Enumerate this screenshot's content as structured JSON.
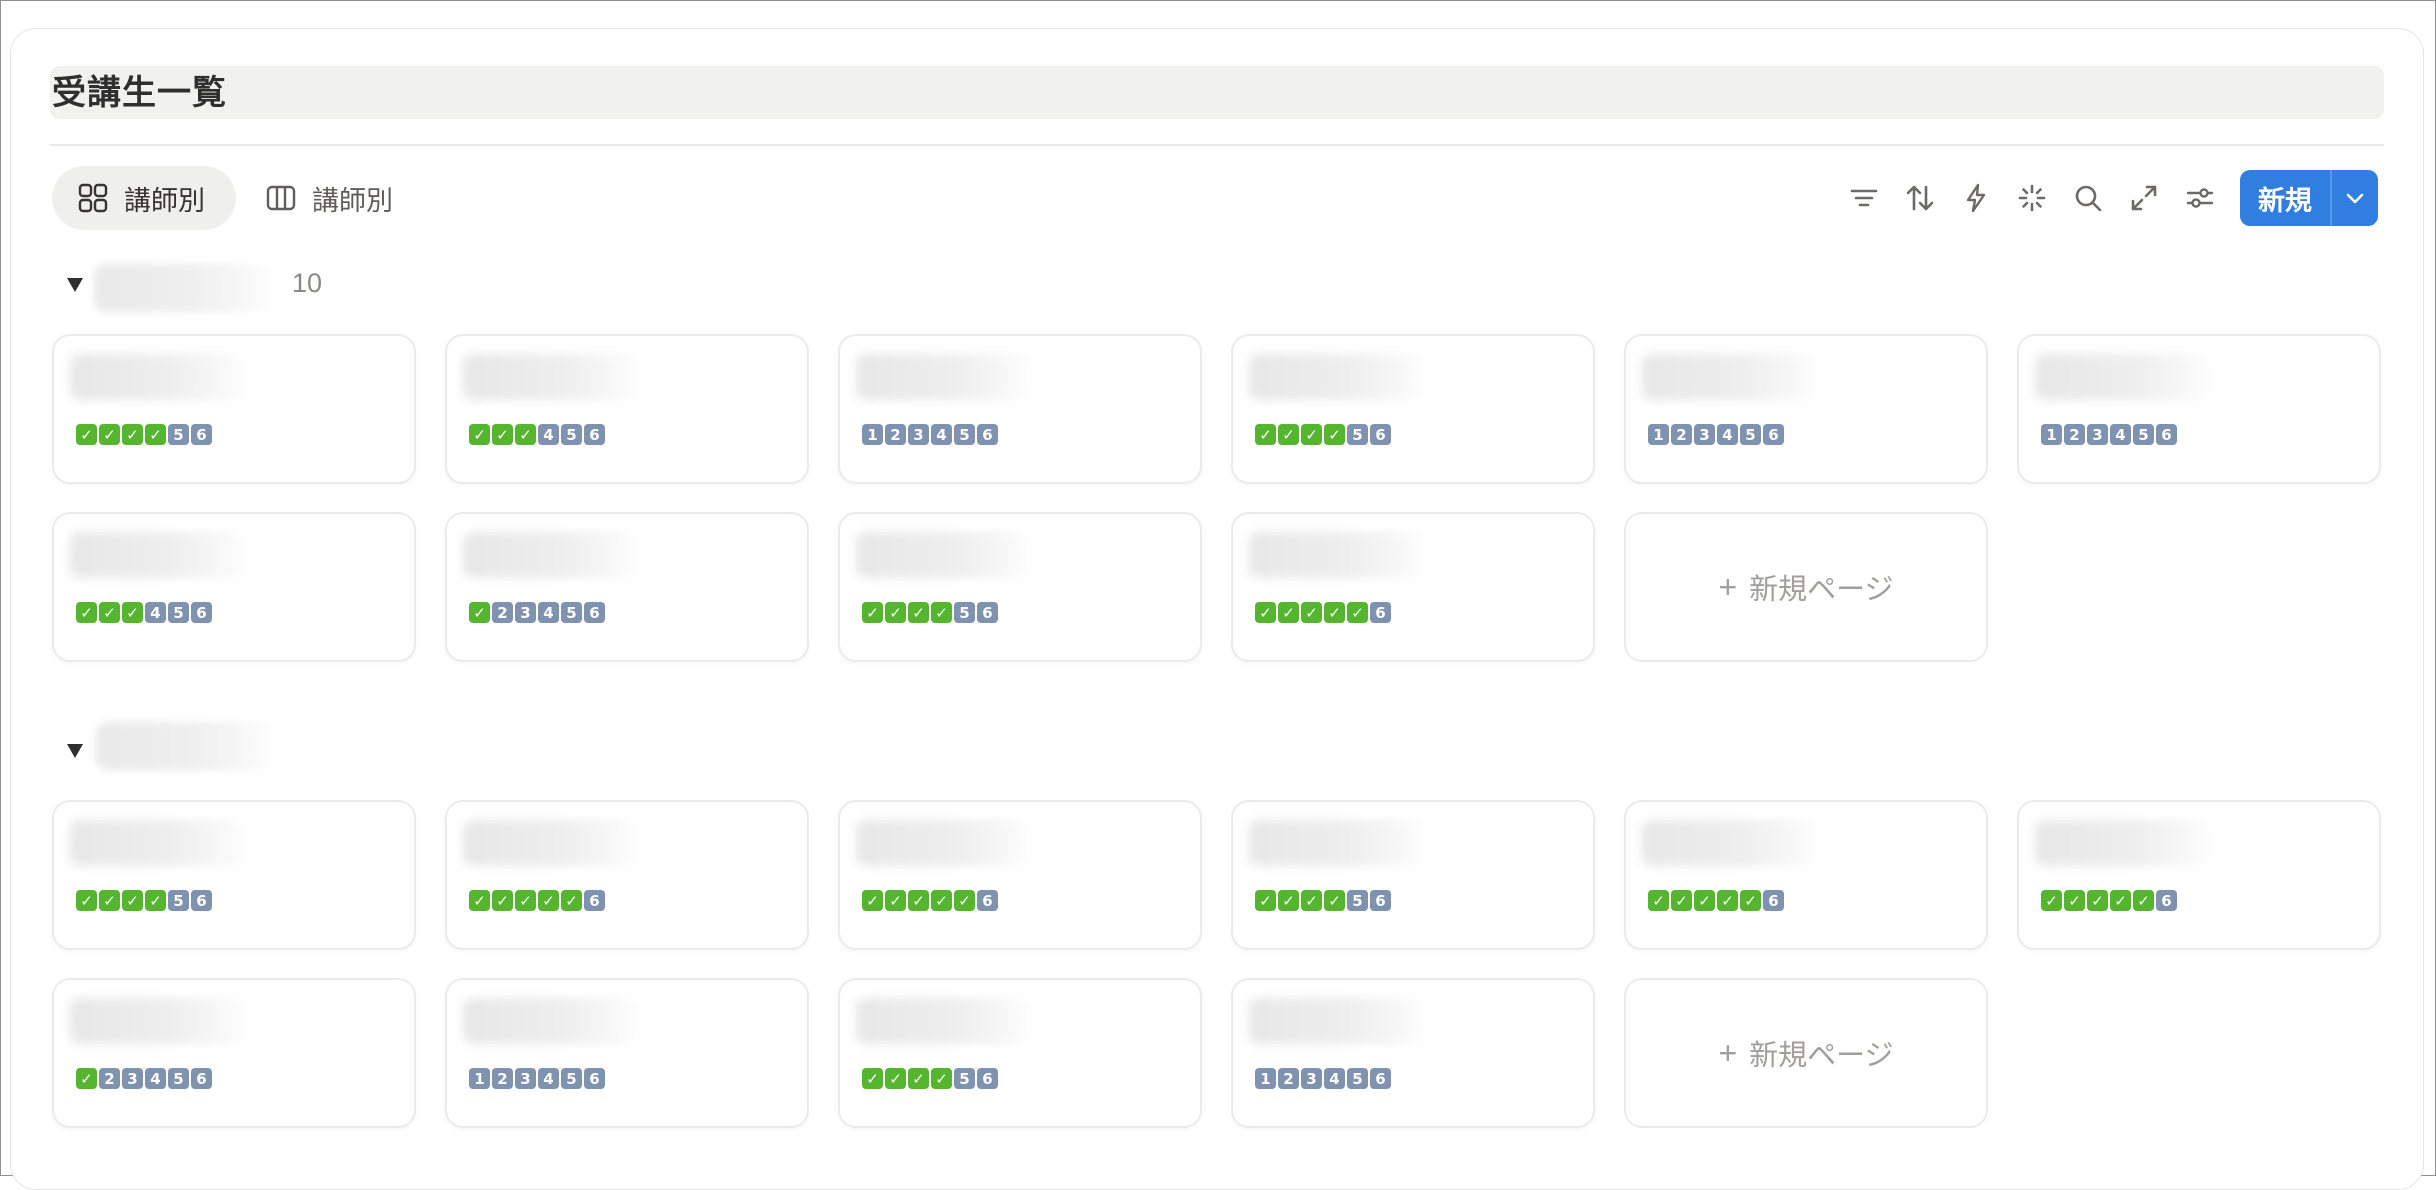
{
  "page": {
    "title": "受講生一覧"
  },
  "views": [
    {
      "label": "講師別",
      "icon": "gallery-grid-icon",
      "active": true
    },
    {
      "label": "講師別",
      "icon": "board-columns-icon",
      "active": false
    }
  ],
  "toolbar": {
    "icons": [
      "filter-icon",
      "sort-icon",
      "automation-bolt-icon",
      "ai-sparkle-icon",
      "search-icon",
      "expand-icon",
      "settings-sliders-icon"
    ],
    "new_label": "新規",
    "new_caret_icon": "chevron-down-icon",
    "accent_color": "#2f7ee0"
  },
  "groups": [
    {
      "count": "10",
      "cards": [
        {
          "progress": [
            "✓",
            "✓",
            "✓",
            "✓",
            "5",
            "6"
          ]
        },
        {
          "progress": [
            "✓",
            "✓",
            "✓",
            "4",
            "5",
            "6"
          ]
        },
        {
          "progress": [
            "1",
            "2",
            "3",
            "4",
            "5",
            "6"
          ]
        },
        {
          "progress": [
            "✓",
            "✓",
            "✓",
            "✓",
            "5",
            "6"
          ]
        },
        {
          "progress": [
            "1",
            "2",
            "3",
            "4",
            "5",
            "6"
          ]
        },
        {
          "progress": [
            "1",
            "2",
            "3",
            "4",
            "5",
            "6"
          ]
        },
        {
          "progress": [
            "✓",
            "✓",
            "✓",
            "4",
            "5",
            "6"
          ]
        },
        {
          "progress": [
            "✓",
            "2",
            "3",
            "4",
            "5",
            "6"
          ]
        },
        {
          "progress": [
            "✓",
            "✓",
            "✓",
            "✓",
            "5",
            "6"
          ]
        },
        {
          "progress": [
            "✓",
            "✓",
            "✓",
            "✓",
            "✓",
            "6"
          ]
        }
      ],
      "new_page_label": "新規ページ"
    },
    {
      "count": "",
      "cards": [
        {
          "progress": [
            "✓",
            "✓",
            "✓",
            "✓",
            "5",
            "6"
          ]
        },
        {
          "progress": [
            "✓",
            "✓",
            "✓",
            "✓",
            "✓",
            "6"
          ]
        },
        {
          "progress": [
            "✓",
            "✓",
            "✓",
            "✓",
            "✓",
            "6"
          ]
        },
        {
          "progress": [
            "✓",
            "✓",
            "✓",
            "✓",
            "5",
            "6"
          ]
        },
        {
          "progress": [
            "✓",
            "✓",
            "✓",
            "✓",
            "✓",
            "6"
          ]
        },
        {
          "progress": [
            "✓",
            "✓",
            "✓",
            "✓",
            "✓",
            "6"
          ]
        },
        {
          "progress": [
            "✓",
            "2",
            "3",
            "4",
            "5",
            "6"
          ]
        },
        {
          "progress": [
            "1",
            "2",
            "3",
            "4",
            "5",
            "6"
          ]
        },
        {
          "progress": [
            "✓",
            "✓",
            "✓",
            "✓",
            "5",
            "6"
          ]
        },
        {
          "progress": [
            "1",
            "2",
            "3",
            "4",
            "5",
            "6"
          ]
        }
      ],
      "new_page_label": "新規ページ"
    }
  ],
  "colors": {
    "done_chip": "#55b52f",
    "todo_chip": "#7f93b0"
  }
}
